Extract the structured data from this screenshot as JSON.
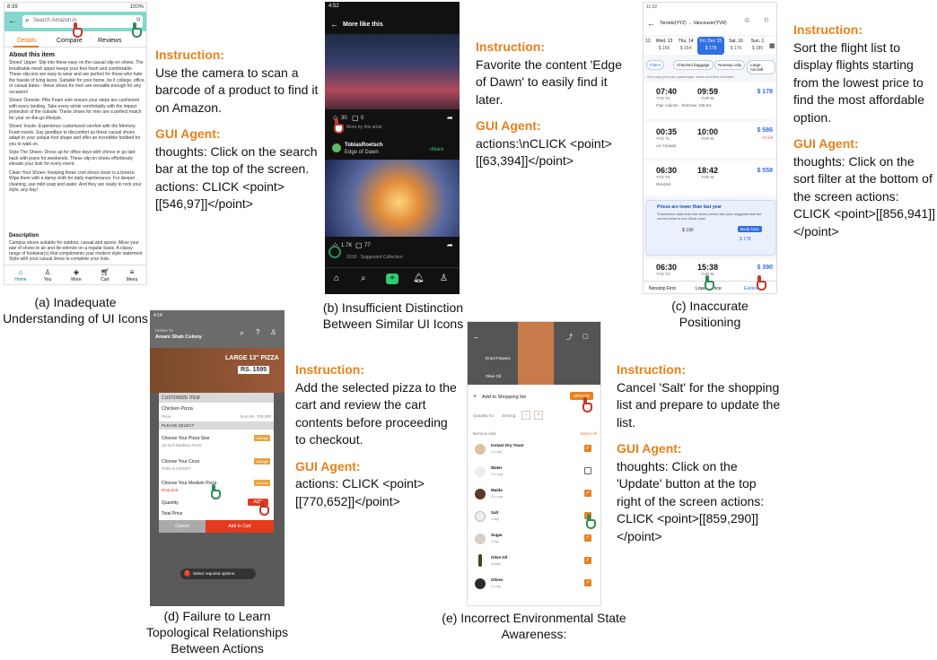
{
  "panels": {
    "a": {
      "caption": "(a) Inadequate Understanding of UI Icons",
      "status": "8:39",
      "battery": "100%",
      "search_placeholder": "Search Amazon.in",
      "tabs": [
        "Details",
        "Compare",
        "Reviews"
      ],
      "about_title": "About this item",
      "bullets": [
        "Shoes' Upper- Slip into these easy on the casual slip-on shoes. The breathable mesh upper keeps your feet fresh and comfortable. These slip-ons are easy to wear and are perfect for those who hate the hassle of tying laces. Suitable for your home, be it college, office, or casual dates - these shoes for men are versatile enough for any occasion!",
        "Shoes' Outsole- Pillo Foam sole ensure your steps are cushioned with every landing. Take every stride comfortably with the impact protection of the outsole. These shoes for men are a perfect match for your on-the-go lifestyle.",
        "Shoes' Insole- Experience customized comfort with the Memory Foam insole. Say goodbye to discomfort as these casual shoes adapt to your unique foot shape and offer an incredible footbed for you to walk on.",
        "Style The Shoes- Dress up for office days with chinos or go laid-back with jeans for weekends. These slip-on shoes effortlessly elevate your look for every event.",
        "Clean Your Shoes- Keeping these cool shoes clean is a breeze. Wipe them with a damp cloth for daily maintenance. For deeper cleaning, use mild soap and water. And they are ready to rock your style, any day!"
      ],
      "desc_title": "Description",
      "desc_text": "Campus shoes suitable for outdoor, casual and sports. Allow your pair of shoes to air and de-odorize on a regular basis. A classy range of footwear(s) that compliments your modern style statement Style with your casual dress to complete your look.",
      "nav": [
        "Home",
        "You",
        "More",
        "Cart",
        "Menu"
      ],
      "instruction_head": "Instruction:",
      "instruction": "Use the camera to scan a barcode of a product to find it on Amazon.",
      "agent_head": "GUI Agent:",
      "agent_text": "thoughts: Click on the search bar at the top of the screen. actions: CLICK <point>[[546,97]]</point>"
    },
    "b": {
      "caption": "(b) Insufficient Distinction Between Similar UI Icons",
      "status": "4:52",
      "title": "More like this",
      "likes": "30",
      "comments": "0",
      "more_by": "More by this artist",
      "author": "TobiasRoetsch",
      "work": "Edge of Dawn",
      "match": "+Match",
      "likes2": "1.7K",
      "comments2": "77",
      "sugg": "2018 · Suggested Collection",
      "instruction_head": "Instruction:",
      "instruction": "Favorite the content 'Edge of Dawn' to easily find it later.",
      "agent_head": "GUI Agent:",
      "agent_text": "actions:\\nCLICK <point>[[63,394]]</point>"
    },
    "c": {
      "caption": "(c) Inaccurate Positioning",
      "status": "11:02",
      "route": "Toronto(YYZ) → Vancouver(YVR)",
      "dates": [
        {
          "d": "12",
          "p": ""
        },
        {
          "d": "Wed, 13",
          "p": "$ 166"
        },
        {
          "d": "Thu, 14",
          "p": "$ 164"
        },
        {
          "d": "Fri, Dec 15",
          "p": "$ 178"
        },
        {
          "d": "Sat, 16",
          "p": "$ 176"
        },
        {
          "d": "Sun, 1",
          "p": "$ 180"
        }
      ],
      "filters": [
        "Filters",
        "Checked baggage",
        "Nonstop only",
        "Large Aircraft"
      ],
      "note": "One-way price per passenger, taxes and fees included",
      "flights": [
        {
          "dep": "07:40",
          "arr": "09:59",
          "fr": "YYZ T3",
          "to": "YVR M",
          "price": "$ 178",
          "air": "Flair Airlines · Embraer 195-E2",
          "extra": ""
        },
        {
          "dep": "00:35",
          "arr": "10:00",
          "fr": "YYZ T1",
          "to": "YVR M",
          "price": "$ 586",
          "air": "Air Canada",
          "extra": "<5 left"
        },
        {
          "dep": "06:30",
          "arr": "18:42",
          "fr": "YYZ T3",
          "to": "YVR M",
          "price": "$ 558",
          "air": "WestJet",
          "extra": ""
        }
      ],
      "promo_title": "Prices are lower than last year",
      "promo_text": "Transaction data from the same period last year suggests that the current price is low. Book now!",
      "lowest": "$ 190",
      "book": "Book Now",
      "book_price": "$ 178",
      "last": {
        "dep": "06:30",
        "arr": "15:38",
        "fr": "YYZ T3",
        "to": "YVR M",
        "price": "$ 390"
      },
      "sorts": [
        "Nonstop First",
        "Lowest Price",
        "Earliest"
      ],
      "instruction_head": "Instruction:",
      "instruction": "Sort the flight list to display flights starting from the lowest price to find the most affordable option.",
      "agent_head": "GUI Agent:",
      "agent_text": "thoughts: Click on the sort filter at the bottom of the screen actions: CLICK <point>[[856,941]]</point>"
    },
    "d": {
      "caption": "(d) Failure to Learn Topological Relationships Between Actions",
      "status": "4:14",
      "deliver": "Deliver To",
      "address": "Amani Shah Colony",
      "banner": "LARGE 13\" PIZZA",
      "banner_price": "RS. 1595",
      "modal_title": "CUSTOMIZE ITEM",
      "item": "Chicken Pizza",
      "price_label": "Price",
      "price_val": "from Rs. 700.000",
      "select": "PLEASE SELECT",
      "options": [
        {
          "t": "Choose Your Pizza Size",
          "s": "10-Inch Medium Pizza",
          "btn": "Change"
        },
        {
          "t": "Choose Your Crust",
          "s": "THIN & CRISPY",
          "btn": "Change"
        },
        {
          "t": "Choose Your Medium Pizza",
          "s": "Required",
          "btn": "Choose"
        }
      ],
      "qty": "Quantity",
      "total": "Total Price",
      "add": "ADD",
      "cancel": "Cancel",
      "add_cart": "Add to Cart",
      "toast": "Select required options.",
      "instruction_head": "Instruction:",
      "instruction": "Add the selected pizza to the cart and review the cart contents before proceeding to checkout.",
      "agent_head": "GUI Agent:",
      "agent_text": "actions: CLICK <point>[[770,652]]</point>"
    },
    "e": {
      "caption": "(e) Incorrect Environmental State Awareness:",
      "sheet_title": "Add to Shopping list",
      "update": "UPDATE",
      "qty_label": "Quantity for",
      "serving": "Serving",
      "items_label": "Items to Add",
      "select_all": "Select All",
      "items": [
        {
          "n": "Instant Dry Yeast",
          "q": "1¼ tsp",
          "c": true
        },
        {
          "n": "Water",
          "q": "1¼ cup",
          "c": false
        },
        {
          "n": "Maida",
          "q": "2¼ cup",
          "c": true
        },
        {
          "n": "Salt",
          "q": "1 tsp",
          "c": true
        },
        {
          "n": "Sugar",
          "q": "1 tsp",
          "c": true
        },
        {
          "n": "Olive Oil",
          "q": "4 tbsp",
          "c": true
        },
        {
          "n": "Olives",
          "q": "½ cup",
          "c": true
        }
      ],
      "bg_items": [
        "Dried Flowers",
        "Olive Oil"
      ],
      "instruction_head": "Instruction:",
      "instruction": "Cancel 'Salt' for the shopping list and prepare to update the list.",
      "agent_head": "GUI Agent:",
      "agent_text": "thoughts: Click on the 'Update' button at the top right of the screen actions: CLICK <point>[[859,290]]</point>"
    }
  }
}
